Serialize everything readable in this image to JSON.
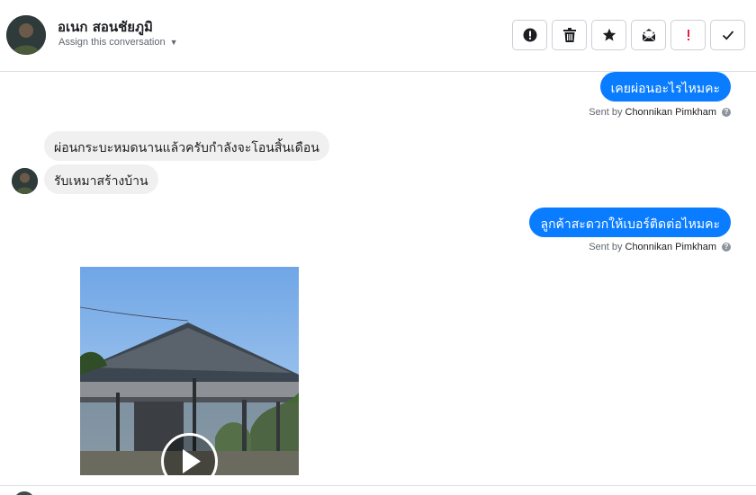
{
  "header": {
    "contact_name": "อเนก สอนชัยภูมิ",
    "assign_label": "Assign this conversation"
  },
  "toolbar": {
    "buttons": [
      {
        "name": "mark-spam",
        "icon": "exclamation-circle-icon"
      },
      {
        "name": "delete",
        "icon": "trash-icon"
      },
      {
        "name": "star",
        "icon": "star-icon"
      },
      {
        "name": "mark-unread",
        "icon": "envelope-icon"
      },
      {
        "name": "important",
        "icon": "exclamation-icon"
      },
      {
        "name": "done",
        "icon": "check-icon"
      }
    ]
  },
  "messages": [
    {
      "direction": "out",
      "text": "เคยผ่อนอะไรไหมคะ",
      "sent_by_prefix": "Sent by",
      "agent": "Chonnikan Pimkham"
    },
    {
      "direction": "in",
      "text": "ผ่อนกระบะหมดนานแล้วครับกำลังจะโอนสิ้นเดือน"
    },
    {
      "direction": "in",
      "text": "รับเหมาสร้างบ้าน"
    },
    {
      "direction": "out",
      "text": "ลูกค้าสะดวกให้เบอร์ติดต่อไหมคะ",
      "sent_by_prefix": "Sent by",
      "agent": "Chonnikan Pimkham"
    },
    {
      "direction": "in",
      "type": "video",
      "icon": "play-icon"
    }
  ],
  "colors": {
    "outgoing_bubble": "#0a7cff",
    "incoming_bubble": "#f0f0f0",
    "important_red": "#e41e3f"
  }
}
